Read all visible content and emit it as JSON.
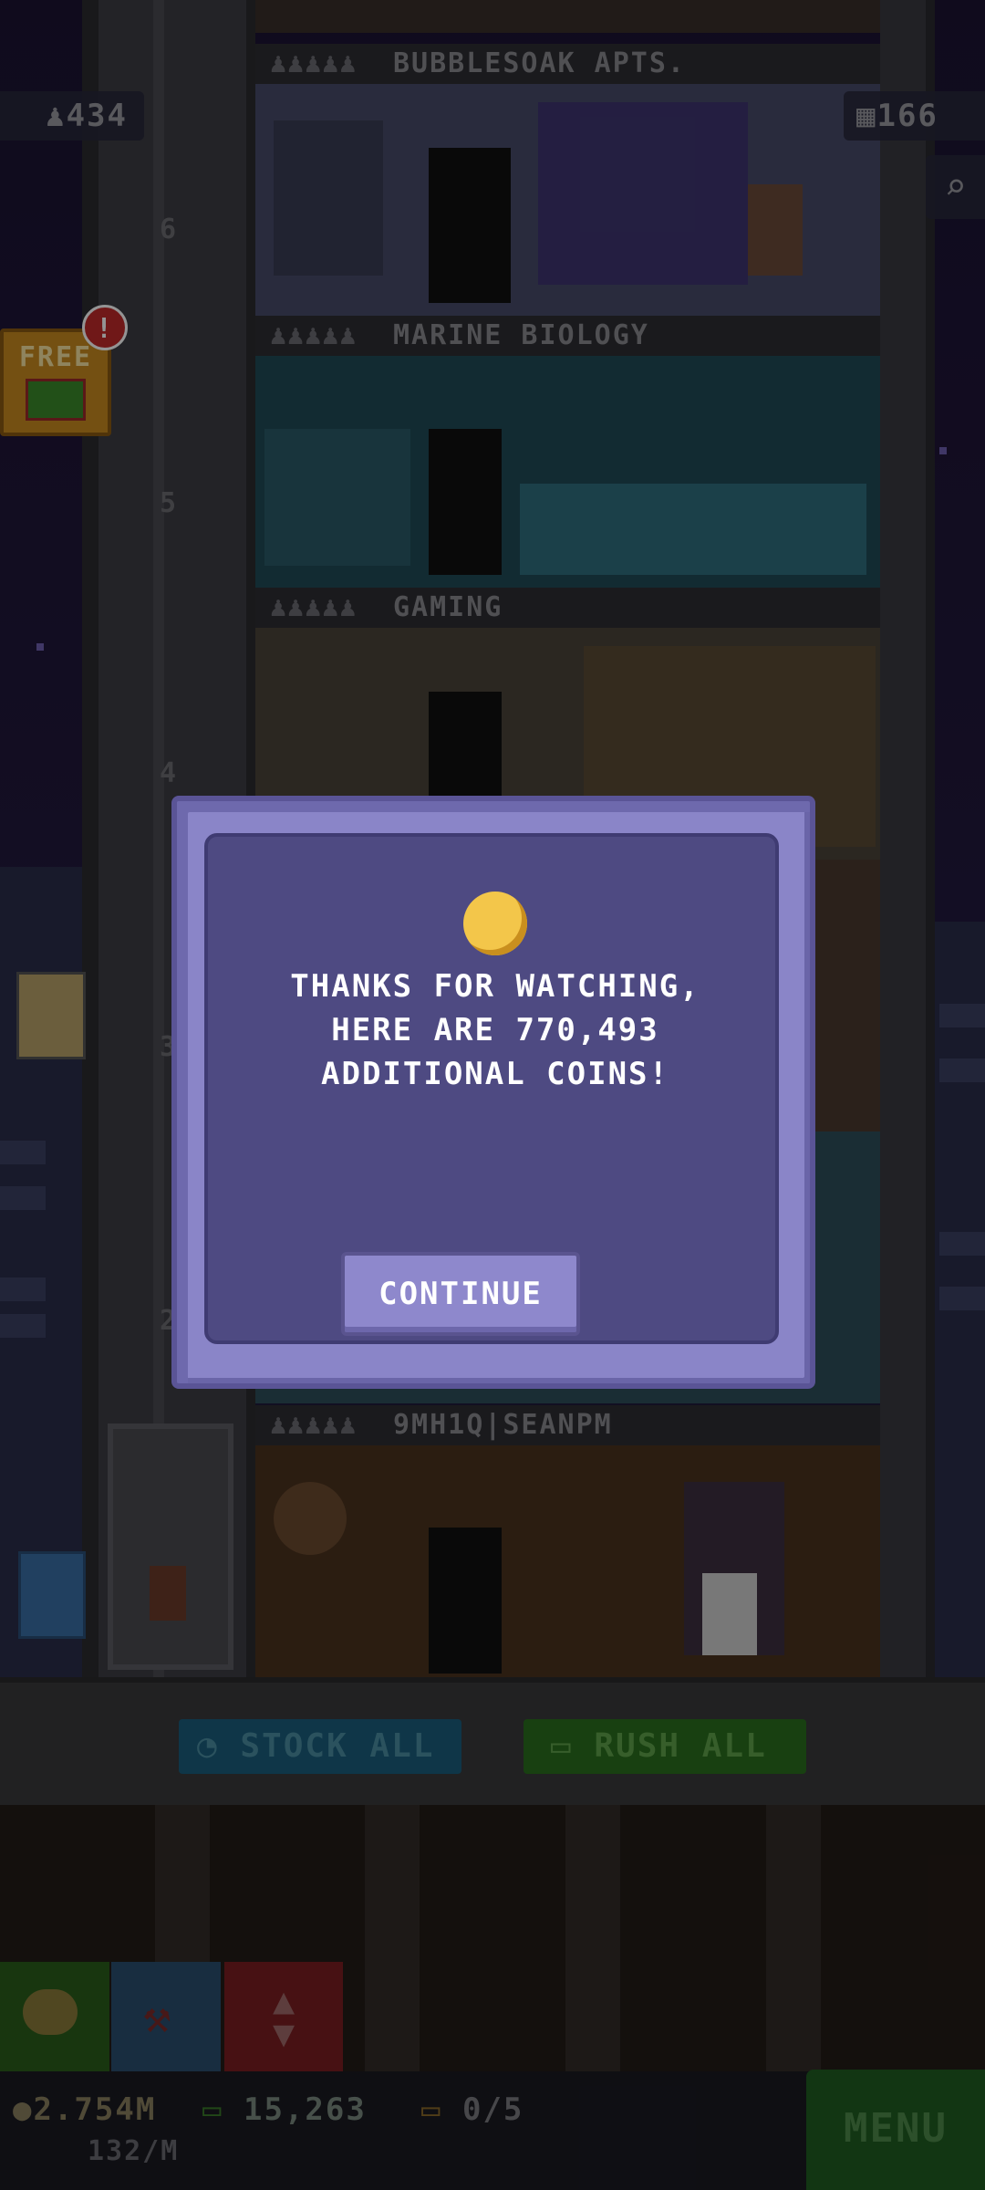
{
  "hud": {
    "population": "434",
    "floors_count": "166",
    "free_gift_label": "FREE",
    "gift_badge": "!"
  },
  "floors": [
    {
      "name": "BUBBLESOAK APTS.",
      "people": "♟♟♟♟♟"
    },
    {
      "name": "MARINE BIOLOGY",
      "people": "♟♟♟♟♟"
    },
    {
      "name": "GAMING",
      "people": "♟♟♟♟♟"
    },
    {
      "name": "9MH1Q|SEANPM",
      "people": "♟♟♟♟♟"
    }
  ],
  "elevator_floor_numbers": [
    "6",
    "5",
    "4",
    "3",
    "2"
  ],
  "actions": {
    "stock_all": "STOCK ALL",
    "rush_all": "RUSH ALL"
  },
  "status": {
    "coins": "2.754M",
    "coins_rate": "132/M",
    "bux": "15,263",
    "tickets": "0/5",
    "menu": "MENU"
  },
  "dialog": {
    "line1": "THANKS FOR WATCHING,",
    "line2": "HERE ARE 770,493",
    "line3": "ADDITIONAL COINS!",
    "button": "CONTINUE"
  },
  "colors": {
    "dialog_outer": "#8a85c8",
    "dialog_inner": "#4e4a82",
    "stock_btn": "#2a7fa6",
    "rush_btn": "#3d9a2a",
    "menu_btn": "#2f8f2f",
    "coin": "#f3c64a"
  },
  "icons": [
    "person-icon",
    "floors-icon",
    "search-icon",
    "gift-icon",
    "clock-icon",
    "cash-icon",
    "coins-icon",
    "hammer-icon",
    "elevator-arrows-icon",
    "ticket-icon"
  ]
}
